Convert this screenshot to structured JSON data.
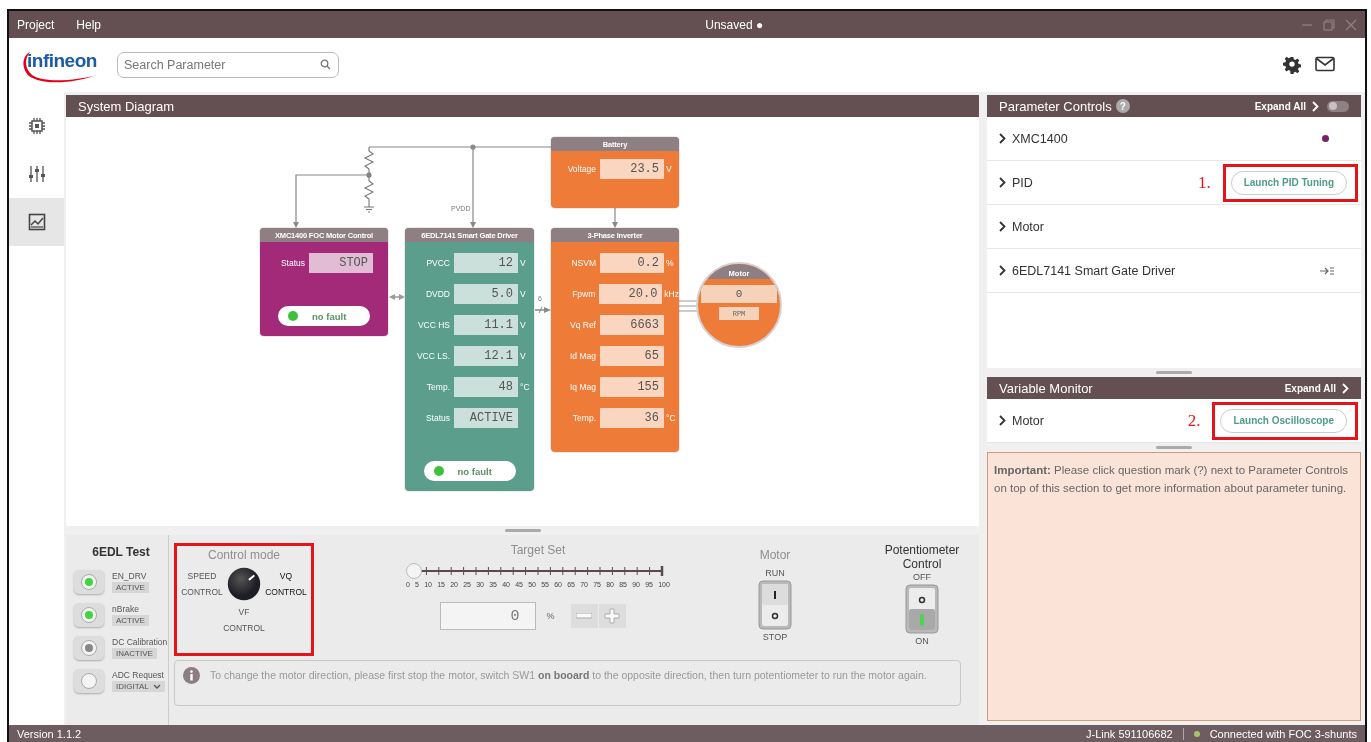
{
  "menu": [
    {
      "label": "Project"
    },
    {
      "label": "Help"
    }
  ],
  "window": {
    "title": "Unsaved ●"
  },
  "header": {
    "logo": "infineon",
    "search": {
      "placeholder": "Search Parameter"
    }
  },
  "sidebar": {
    "items": [
      {
        "kind": "chip",
        "selected": false
      },
      {
        "kind": "sliders",
        "selected": false
      },
      {
        "kind": "chart",
        "selected": true
      }
    ]
  },
  "diagram": {
    "title": "System Diagram",
    "wire_label": "PVDD",
    "bus_label": "6",
    "blocks": [
      {
        "kind": "controller",
        "title": "XMC1400 FOC Motor Control",
        "color": "#a32a78",
        "readings": [
          {
            "label": "Status",
            "value": "STOP"
          }
        ],
        "fault": "no fault",
        "fault_ok": true
      },
      {
        "kind": "driver",
        "title": "6EDL7141 Smart Gate Driver",
        "color": "#5b9e8c",
        "readings": [
          {
            "label": "PVCC",
            "value": "12",
            "unit": "V"
          },
          {
            "label": "DVDD",
            "value": "5.0",
            "unit": "V"
          },
          {
            "label": "VCC HS",
            "value": "11.1",
            "unit": "V"
          },
          {
            "label": "VCC LS.",
            "value": "12.1",
            "unit": "V"
          },
          {
            "label": "Temp.",
            "value": "48",
            "unit": "°C"
          },
          {
            "label": "Status",
            "value": "ACTIVE"
          }
        ],
        "fault": "no fault",
        "fault_ok": true
      },
      {
        "kind": "battery",
        "title": "Battery",
        "color": "#ee7b38",
        "readings": [
          {
            "label": "Voltage",
            "value": "23.5",
            "unit": "V"
          }
        ]
      },
      {
        "kind": "inverter",
        "title": "3-Phase Inverter",
        "color": "#ee7b38",
        "readings": [
          {
            "label": "NSVM",
            "value": "0.2",
            "unit": "%"
          },
          {
            "label": "Fpwm",
            "value": "20.0",
            "unit": "kHz"
          },
          {
            "label": "Vq Ref",
            "value": "6663"
          },
          {
            "label": "Id Mag",
            "value": "65"
          },
          {
            "label": "Iq Mag",
            "value": "155"
          },
          {
            "label": "Temp.",
            "value": "36",
            "unit": "°C"
          }
        ]
      }
    ],
    "motor": {
      "title": "Motor",
      "value": "0",
      "unit": "RPM"
    }
  },
  "test_panel": {
    "title": "6EDL Test",
    "items": [
      {
        "kind": "indicator",
        "label": "EN_DRV",
        "state": "ACTIVE",
        "on": true
      },
      {
        "kind": "indicator",
        "label": "nBrake",
        "state": "ACTIVE",
        "on": true
      },
      {
        "kind": "indicator",
        "label": "DC Calibration",
        "state": "INACTIVE",
        "on": false
      },
      {
        "kind": "select",
        "label": "ADC Request",
        "state": "IDIGITAL"
      }
    ]
  },
  "control_mode": {
    "title": "Control mode",
    "disabled": true,
    "highlighted": true,
    "options": [
      {
        "label": "SPEED CONTROL",
        "selected": false
      },
      {
        "label": "VQ CONTROL",
        "selected": true
      },
      {
        "label": "VF CONTROL",
        "selected": false
      }
    ]
  },
  "target_set": {
    "title": "Target Set",
    "disabled": true,
    "level": 0,
    "ticks": [
      "0",
      "5",
      "10",
      "15",
      "20",
      "25",
      "30",
      "35",
      "40",
      "45",
      "50",
      "55",
      "60",
      "65",
      "70",
      "75",
      "80",
      "85",
      "90",
      "95",
      "100"
    ],
    "value": "0",
    "unit": "%"
  },
  "switches": [
    {
      "title": "Motor",
      "disabled": true,
      "top": "RUN",
      "bottom": "STOP",
      "on": false
    },
    {
      "title": "Potentiometer Control",
      "disabled": false,
      "top": "OFF",
      "bottom": "ON",
      "on": true
    }
  ],
  "info": "To change the motor direction, please first stop the motor, switch SW1 **on booard** to the opposite direction, then turn potentiometer to run the motor again.",
  "parameter_controls": {
    "title": "Parameter Controls",
    "help": "?",
    "expand_all": "Expand All",
    "toggle_on": false,
    "items": [
      {
        "kind": "dot",
        "label": "XMC1400"
      },
      {
        "kind": "button",
        "label": "PID",
        "button": "Launch PID Tuning",
        "annotation": "1.",
        "highlighted": true
      },
      {
        "kind": "plain",
        "label": "Motor"
      },
      {
        "kind": "action",
        "label": "6EDL7141 Smart Gate Driver"
      }
    ]
  },
  "variable_monitor": {
    "title": "Variable Monitor",
    "expand_all": "Expand All",
    "items": [
      {
        "kind": "button",
        "label": "Motor",
        "button": "Launch Oscilloscope",
        "annotation": "2.",
        "highlighted": true
      }
    ]
  },
  "note": "**Important:** Please click question mark (?) next to Parameter Controls on top of this section to get more information about parameter tuning.",
  "status_bar": {
    "version": "Version 1.1.2",
    "jlink": "J-Link 591106682",
    "connection": "Connected with FOC 3-shunts",
    "connected": true
  }
}
